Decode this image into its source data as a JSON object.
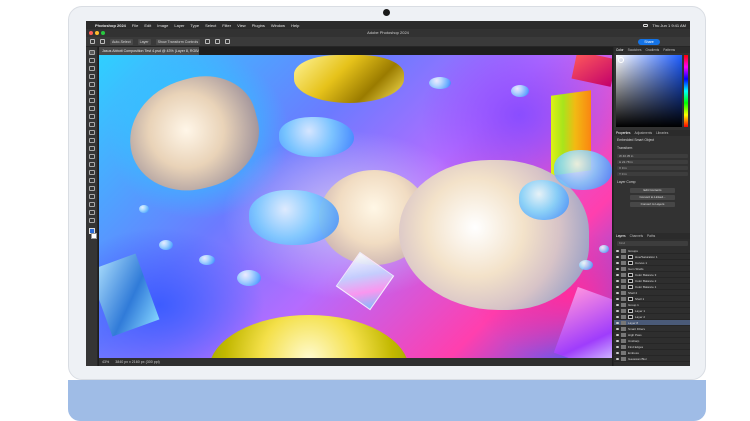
{
  "menubar": {
    "items": [
      "Photoshop 2024",
      "File",
      "Edit",
      "Image",
      "Layer",
      "Type",
      "Select",
      "Filter",
      "View",
      "Plugins",
      "Window",
      "Help"
    ],
    "clock": "Thu Jun 1  9:41 AM"
  },
  "window": {
    "title": "Adobe Photoshop 2024"
  },
  "options_bar": {
    "auto_select": "Auto-Select",
    "layer": "Layer",
    "show_transform": "Show Transform Controls",
    "share": "Share"
  },
  "document": {
    "tab_title": "Jasus Abbott Composition Test 4.psd @ 43% (Layer 8, RGB/8*)"
  },
  "status_bar": {
    "zoom": "43%",
    "info": "3840 px x 2160 px (300 ppi)"
  },
  "panels": {
    "color_tabs": [
      "Color",
      "Swatches",
      "Gradients",
      "Patterns"
    ],
    "properties_tabs": [
      "Properties",
      "Adjustments",
      "Libraries"
    ],
    "properties": {
      "object": "Embedded Smart Object",
      "section": "Transform",
      "fields": [
        "W 40.35 in",
        "H 22.78 in",
        "X 0 in",
        "Y 0 in"
      ],
      "layer_comp": "Layer Comp",
      "buttons": [
        "Edit Contents",
        "Convert to Linked...",
        "Convert to Layers"
      ]
    },
    "layers_tabs": [
      "Layers",
      "Channels",
      "Paths"
    ],
    "layers_search": "Kind",
    "layers": [
      {
        "name": "Groups",
        "sel": false,
        "mask": false
      },
      {
        "name": "Hue/Saturation 1",
        "sel": false,
        "mask": true
      },
      {
        "name": "Curves 1",
        "sel": false,
        "mask": true
      },
      {
        "name": "Gem Shells",
        "sel": false,
        "mask": false
      },
      {
        "name": "Color Balance 3",
        "sel": false,
        "mask": true
      },
      {
        "name": "Color Balance 2",
        "sel": false,
        "mask": true
      },
      {
        "name": "Color Balance 1",
        "sel": false,
        "mask": true
      },
      {
        "name": "Shell 2",
        "sel": false,
        "mask": false
      },
      {
        "name": "Shell 1",
        "sel": false,
        "mask": true
      },
      {
        "name": "Group 1",
        "sel": false,
        "mask": false
      },
      {
        "name": "Layer 1",
        "sel": false,
        "mask": true
      },
      {
        "name": "Layer 2",
        "sel": false,
        "mask": true
      },
      {
        "name": "Layer 8",
        "sel": true,
        "mask": false
      },
      {
        "name": "Smart Filters",
        "sel": false,
        "mask": false
      },
      {
        "name": "High Pass",
        "sel": false,
        "mask": false
      },
      {
        "name": "Unsharp",
        "sel": false,
        "mask": false
      },
      {
        "name": "Find Edges",
        "sel": false,
        "mask": false
      },
      {
        "name": "Emboss",
        "sel": false,
        "mask": false
      },
      {
        "name": "Gaussian Blur",
        "sel": false,
        "mask": false
      }
    ]
  },
  "colors": {
    "accent": "#1473e6",
    "chin": "#9fbce6",
    "panel_bg": "#323232",
    "selected_layer": "#4a5a78"
  }
}
